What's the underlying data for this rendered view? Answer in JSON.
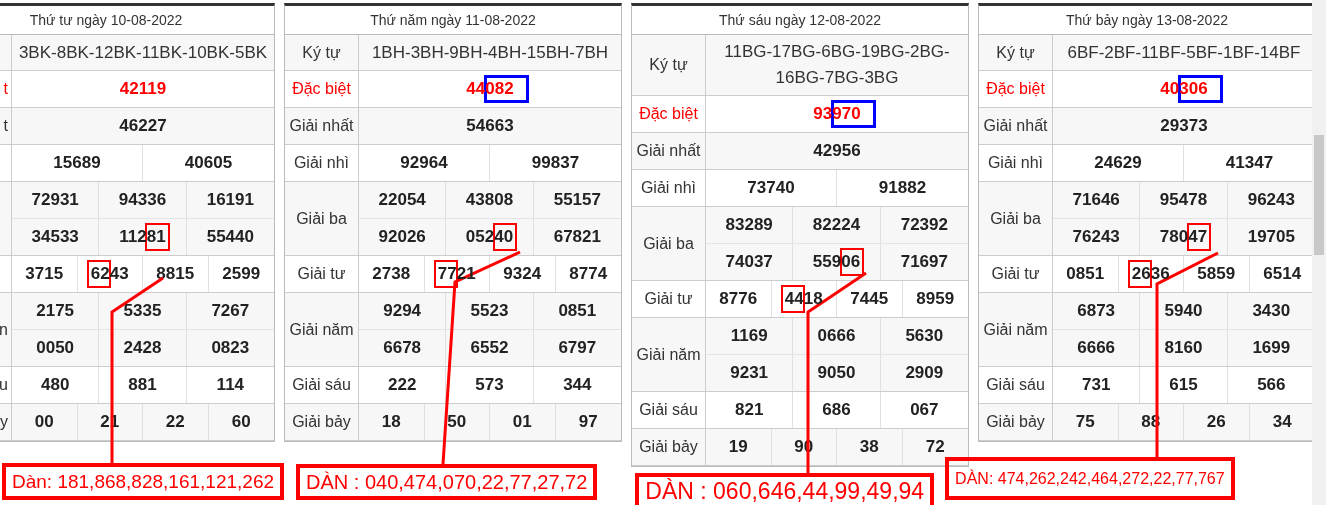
{
  "tables": [
    {
      "date": "Thứ tư ngày 10-08-2022",
      "cut_left": true,
      "rows": [
        {
          "kind": "code",
          "lines": [
            [
              "3BK-8BK-12BK-11BK-10BK-5BK"
            ]
          ]
        },
        {
          "kind": "special",
          "label": "t",
          "lines": [
            [
              "42119"
            ]
          ]
        },
        {
          "kind": "prize",
          "label": "t",
          "lines": [
            [
              "46227"
            ]
          ]
        },
        {
          "kind": "prize",
          "lines": [
            [
              "15689",
              "40605"
            ]
          ]
        },
        {
          "kind": "prize",
          "lines": [
            [
              "72931",
              "94336",
              "16191"
            ],
            [
              "34533",
              {
                "text": "11281",
                "highlight": {
                  "kind": "pair",
                  "at_end": true,
                  "color": "#ff0000"
                }
              },
              "55440"
            ]
          ]
        },
        {
          "kind": "prize",
          "lines": [
            [
              "3715",
              {
                "text": "6243",
                "highlight": {
                  "kind": "pair",
                  "at_end": false,
                  "color": "#ff0000"
                }
              },
              "8815",
              "2599"
            ]
          ]
        },
        {
          "kind": "prize",
          "label": "n",
          "lines": [
            [
              "2175",
              "5335",
              "7267"
            ],
            [
              "0050",
              "2428",
              "0823"
            ]
          ]
        },
        {
          "kind": "prize",
          "label": "u",
          "lines": [
            [
              "480",
              "881",
              "114"
            ]
          ]
        },
        {
          "kind": "prize",
          "label": "y",
          "lines": [
            [
              "00",
              "21",
              "22",
              "60"
            ]
          ]
        }
      ]
    },
    {
      "date": "Thứ năm ngày 11-08-2022",
      "cut_left": false,
      "rows": [
        {
          "kind": "code",
          "label": "Ký tự",
          "lines": [
            [
              "1BH-3BH-9BH-4BH-15BH-7BH"
            ]
          ]
        },
        {
          "kind": "special",
          "label": "Đặc biệt",
          "lines": [
            [
              {
                "text": "44082",
                "highlight": {
                  "kind": "triple",
                  "at_end": true,
                  "color": "#0000ff"
                }
              }
            ]
          ]
        },
        {
          "kind": "prize",
          "label": "Giải nhất",
          "lines": [
            [
              "54663"
            ]
          ]
        },
        {
          "kind": "prize",
          "label": "Giải nhì",
          "lines": [
            [
              "92964",
              "99837"
            ]
          ]
        },
        {
          "kind": "prize",
          "label": "Giải ba",
          "lines": [
            [
              "22054",
              "43808",
              "55157"
            ],
            [
              "92026",
              {
                "text": "05240",
                "highlight": {
                  "kind": "pair",
                  "at_end": true,
                  "color": "#ff0000"
                }
              },
              "67821"
            ]
          ]
        },
        {
          "kind": "prize",
          "label": "Giải tư",
          "lines": [
            [
              "2738",
              {
                "text": "7721",
                "highlight": {
                  "kind": "pair",
                  "at_end": false,
                  "color": "#ff0000"
                }
              },
              "9324",
              "8774"
            ]
          ]
        },
        {
          "kind": "prize",
          "label": "Giải năm",
          "lines": [
            [
              "9294",
              "5523",
              "0851"
            ],
            [
              "6678",
              "6552",
              "6797"
            ]
          ]
        },
        {
          "kind": "prize",
          "label": "Giải sáu",
          "lines": [
            [
              "222",
              "573",
              "344"
            ]
          ]
        },
        {
          "kind": "prize",
          "label": "Giải bảy",
          "lines": [
            [
              "18",
              "50",
              "01",
              "97"
            ]
          ]
        }
      ]
    },
    {
      "date": "Thứ sáu ngày 12-08-2022",
      "cut_left": false,
      "rows": [
        {
          "kind": "code",
          "label": "Ký tự",
          "lines": [
            [
              "11BG-17BG-6BG-19BG-2BG-16BG-7BG-3BG"
            ]
          ]
        },
        {
          "kind": "special",
          "label": "Đặc biệt",
          "lines": [
            [
              {
                "text": "93970",
                "highlight": {
                  "kind": "triple",
                  "at_end": true,
                  "color": "#0000ff"
                }
              }
            ]
          ]
        },
        {
          "kind": "prize",
          "label": "Giải nhất",
          "lines": [
            [
              "42956"
            ]
          ]
        },
        {
          "kind": "prize",
          "label": "Giải nhì",
          "lines": [
            [
              "73740",
              "91882"
            ]
          ]
        },
        {
          "kind": "prize",
          "label": "Giải ba",
          "lines": [
            [
              "83289",
              "82224",
              "72392"
            ],
            [
              "74037",
              {
                "text": "55906",
                "highlight": {
                  "kind": "pair",
                  "at_end": true,
                  "color": "#ff0000"
                }
              },
              "71697"
            ]
          ]
        },
        {
          "kind": "prize",
          "label": "Giải tư",
          "lines": [
            [
              "8776",
              {
                "text": "4418",
                "highlight": {
                  "kind": "pair",
                  "at_end": false,
                  "color": "#ff0000"
                }
              },
              "7445",
              "8959"
            ]
          ]
        },
        {
          "kind": "prize",
          "label": "Giải năm",
          "lines": [
            [
              "1169",
              "0666",
              "5630"
            ],
            [
              "9231",
              "9050",
              "2909"
            ]
          ]
        },
        {
          "kind": "prize",
          "label": "Giải sáu",
          "lines": [
            [
              "821",
              "686",
              "067"
            ]
          ]
        },
        {
          "kind": "prize",
          "label": "Giải bảy",
          "lines": [
            [
              "19",
              "90",
              "38",
              "72"
            ]
          ]
        }
      ]
    },
    {
      "date": "Thứ bảy ngày 13-08-2022",
      "cut_left": false,
      "rows": [
        {
          "kind": "code",
          "label": "Ký tự",
          "lines": [
            [
              "6BF-2BF-11BF-5BF-1BF-14BF"
            ]
          ]
        },
        {
          "kind": "special",
          "label": "Đặc biệt",
          "lines": [
            [
              {
                "text": "40306",
                "highlight": {
                  "kind": "triple",
                  "at_end": true,
                  "color": "#0000ff"
                }
              }
            ]
          ]
        },
        {
          "kind": "prize",
          "label": "Giải nhất",
          "lines": [
            [
              "29373"
            ]
          ]
        },
        {
          "kind": "prize",
          "label": "Giải nhì",
          "lines": [
            [
              "24629",
              "41347"
            ]
          ]
        },
        {
          "kind": "prize",
          "label": "Giải ba",
          "lines": [
            [
              "71646",
              "95478",
              "96243"
            ],
            [
              "76243",
              {
                "text": "78047",
                "highlight": {
                  "kind": "pair",
                  "at_end": true,
                  "color": "#ff0000"
                }
              },
              "19705"
            ]
          ]
        },
        {
          "kind": "prize",
          "label": "Giải tư",
          "lines": [
            [
              "0851",
              {
                "text": "2636",
                "highlight": {
                  "kind": "pair",
                  "at_end": false,
                  "color": "#ff0000"
                }
              },
              "5859",
              "6514"
            ]
          ]
        },
        {
          "kind": "prize",
          "label": "Giải năm",
          "lines": [
            [
              "6873",
              "5940",
              "3430"
            ],
            [
              "6666",
              "8160",
              "1699"
            ]
          ]
        },
        {
          "kind": "prize",
          "label": "Giải sáu",
          "lines": [
            [
              "731",
              "615",
              "566"
            ]
          ]
        },
        {
          "kind": "prize",
          "label": "Giải bảy",
          "lines": [
            [
              "75",
              "88",
              "26",
              "34"
            ]
          ]
        }
      ]
    }
  ],
  "dan": [
    {
      "text": "Dàn: 181,868,828,161,121,262"
    },
    {
      "text": "DÀN : 040,474,070,22,77,27,72"
    },
    {
      "text": "DÀN : 060,646,44,99,49,94"
    },
    {
      "text": "DÀN: 474,262,242,464,272,22,77,767"
    }
  ]
}
